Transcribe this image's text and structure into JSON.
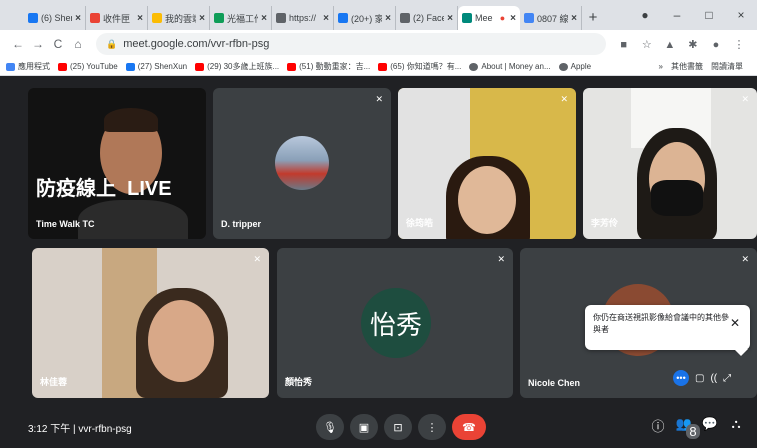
{
  "tabs": [
    {
      "title": "(6) Shen",
      "color": "#1877f2"
    },
    {
      "title": "收件匣",
      "color": "#ea4335"
    },
    {
      "title": "我的雲端",
      "color": "#fbbc04"
    },
    {
      "title": "光福工作",
      "color": "#0f9d58"
    },
    {
      "title": "https://",
      "color": "#5f6368"
    },
    {
      "title": "(20+) 家",
      "color": "#1877f2"
    },
    {
      "title": "(2) Face",
      "color": "#5f6368"
    },
    {
      "title": "Mee",
      "color": "#00897b",
      "active": true
    },
    {
      "title": "0807 線",
      "color": "#4285f4"
    }
  ],
  "tab_close": "×",
  "new_tab": "+",
  "window": {
    "profile": "●",
    "minimize": "–",
    "maximize": "□",
    "close": "×"
  },
  "nav": {
    "back": "←",
    "forward": "→",
    "reload": "C",
    "home": "⌂"
  },
  "url": "meet.google.com/vvr-rfbn-psg",
  "lock_icon": "🔒",
  "toolbar_icons": [
    "■",
    "☆",
    "▲",
    "✱",
    "●",
    "⋮"
  ],
  "bookmarks": [
    {
      "label": "應用程式",
      "color": "#4285f4"
    },
    {
      "label": "(25) YouTube",
      "color": "#ff0000"
    },
    {
      "label": "(27) ShenXun",
      "color": "#1877f2"
    },
    {
      "label": "(29) 30多歲上班族...",
      "color": "#ff0000"
    },
    {
      "label": "(51) 動動重家：吉...",
      "color": "#ff0000"
    },
    {
      "label": "(65) 你知道嗎？有...",
      "color": "#ff0000"
    },
    {
      "label": "About | Money an...",
      "color": "#5f6368"
    },
    {
      "label": "Apple",
      "color": "#5f6368"
    }
  ],
  "bookmarks_right": [
    "»",
    "其他書籤",
    "閱讀清單"
  ],
  "participants": [
    {
      "name": "Time Walk TC",
      "overlay": "防疫線上  LIVE"
    },
    {
      "name": "D. tripper"
    },
    {
      "name": "徐筠皓"
    },
    {
      "name": "李芳伶"
    },
    {
      "name": "林佳蓉"
    },
    {
      "name": "顏怡秀",
      "initials": "怡秀"
    },
    {
      "name": "Nicole Chen"
    }
  ],
  "mute_icon": "✕",
  "popup": {
    "text": "你仍在商送視訊影像給會議中的其他參與者",
    "close": "✕"
  },
  "tile_controls": {
    "more": "•••",
    "a": "▢",
    "b": "((",
    "c": "⤢"
  },
  "meeting_info": "3:12 下午 | vvr-rfbn-psg",
  "controls": {
    "mic": "🎙",
    "cam": "▣",
    "present": "⊡",
    "more": "⋮",
    "end": "☎"
  },
  "right_controls": {
    "info": "ⓘ",
    "people": "👥",
    "people_count": "8",
    "chat": "💬",
    "activities": "⛬"
  }
}
